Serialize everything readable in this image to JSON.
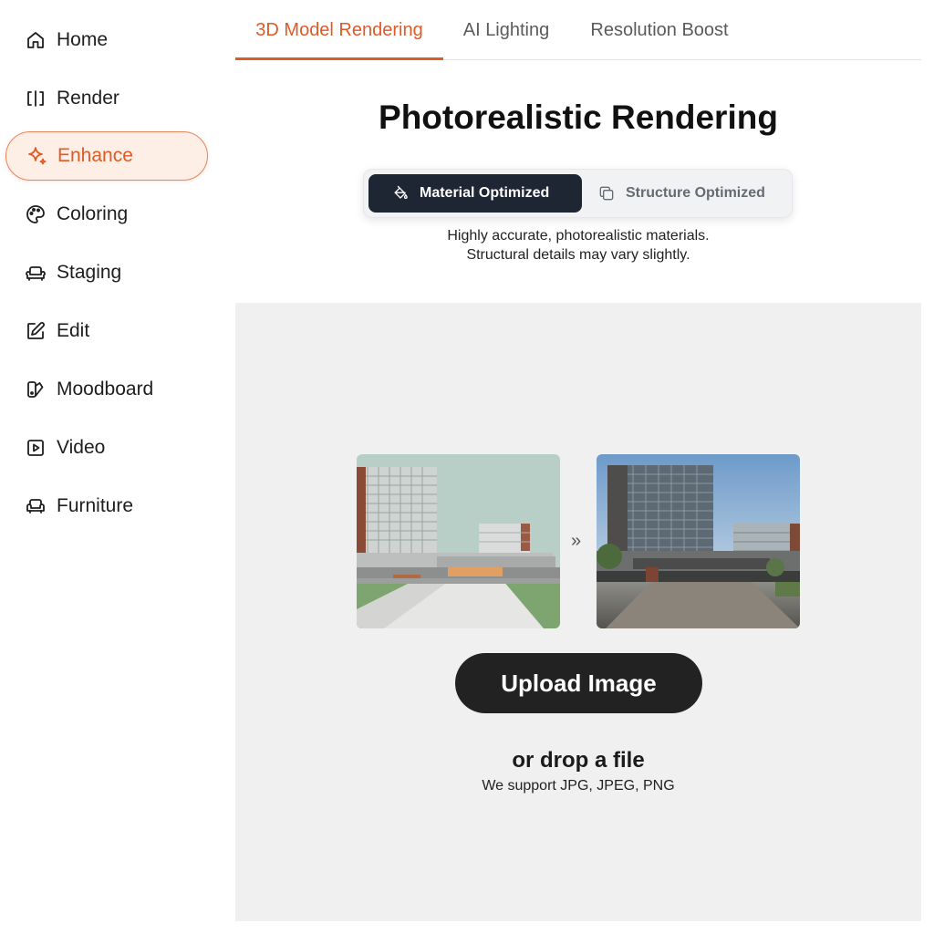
{
  "sidebar": {
    "items": [
      {
        "label": "Home",
        "icon": "home-icon"
      },
      {
        "label": "Render",
        "icon": "render-icon"
      },
      {
        "label": "Enhance",
        "icon": "sparkle-icon",
        "active": true
      },
      {
        "label": "Coloring",
        "icon": "palette-icon"
      },
      {
        "label": "Staging",
        "icon": "sofa-icon"
      },
      {
        "label": "Edit",
        "icon": "edit-icon"
      },
      {
        "label": "Moodboard",
        "icon": "moodboard-icon"
      },
      {
        "label": "Video",
        "icon": "play-icon"
      },
      {
        "label": "Furniture",
        "icon": "armchair-icon"
      }
    ]
  },
  "tabs": [
    {
      "label": "3D Model Rendering",
      "active": true
    },
    {
      "label": "AI Lighting"
    },
    {
      "label": "Resolution Boost"
    }
  ],
  "main": {
    "title": "Photorealistic Rendering",
    "mode_toggle": {
      "options": [
        {
          "label": "Material Optimized",
          "icon": "paint-bucket-icon",
          "active": true
        },
        {
          "label": "Structure Optimized",
          "icon": "copy-icon"
        }
      ]
    },
    "description": {
      "line1": "Highly accurate, photorealistic materials.",
      "line2": "Structural details may vary slightly."
    },
    "upload": {
      "arrow": "»",
      "button_label": "Upload Image",
      "drop_title": "or drop a file",
      "formats": "We support JPG, JPEG, PNG"
    }
  },
  "colors": {
    "accent": "#e05a26",
    "active_bg": "#fdeee6",
    "dark_button": "#222222",
    "toggle_active": "#1f2633",
    "upload_bg": "#f0f0f0"
  }
}
